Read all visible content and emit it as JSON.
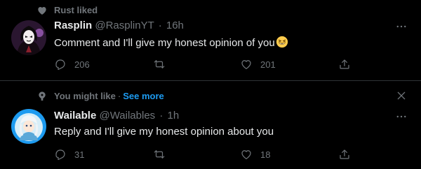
{
  "tweets": [
    {
      "social_context": {
        "text": "Rust liked",
        "icon": "heart-icon"
      },
      "author": {
        "name": "Rasplin",
        "handle": "@RasplinYT",
        "separator": "·",
        "time": "16h"
      },
      "text": "Comment and I'll give my honest opinion of you",
      "emoji": "grinning-squinting-face",
      "actions": {
        "reply_count": "206",
        "retweet_count": "",
        "like_count": "201"
      }
    },
    {
      "social_context": {
        "text": "You might like",
        "separator": "·",
        "see_more": "See more",
        "icon": "pin-icon"
      },
      "author": {
        "name": "Wailable",
        "handle": "@Wailables",
        "separator": "·",
        "time": "1h"
      },
      "text": "Reply and I'll give my honest opinion about you",
      "actions": {
        "reply_count": "31",
        "retweet_count": "",
        "like_count": "18"
      }
    }
  ],
  "colors": {
    "background": "#000000",
    "text_primary": "#e7e9ea",
    "text_secondary": "#71767b",
    "link": "#1d9bf0",
    "divider": "#2f3336"
  }
}
